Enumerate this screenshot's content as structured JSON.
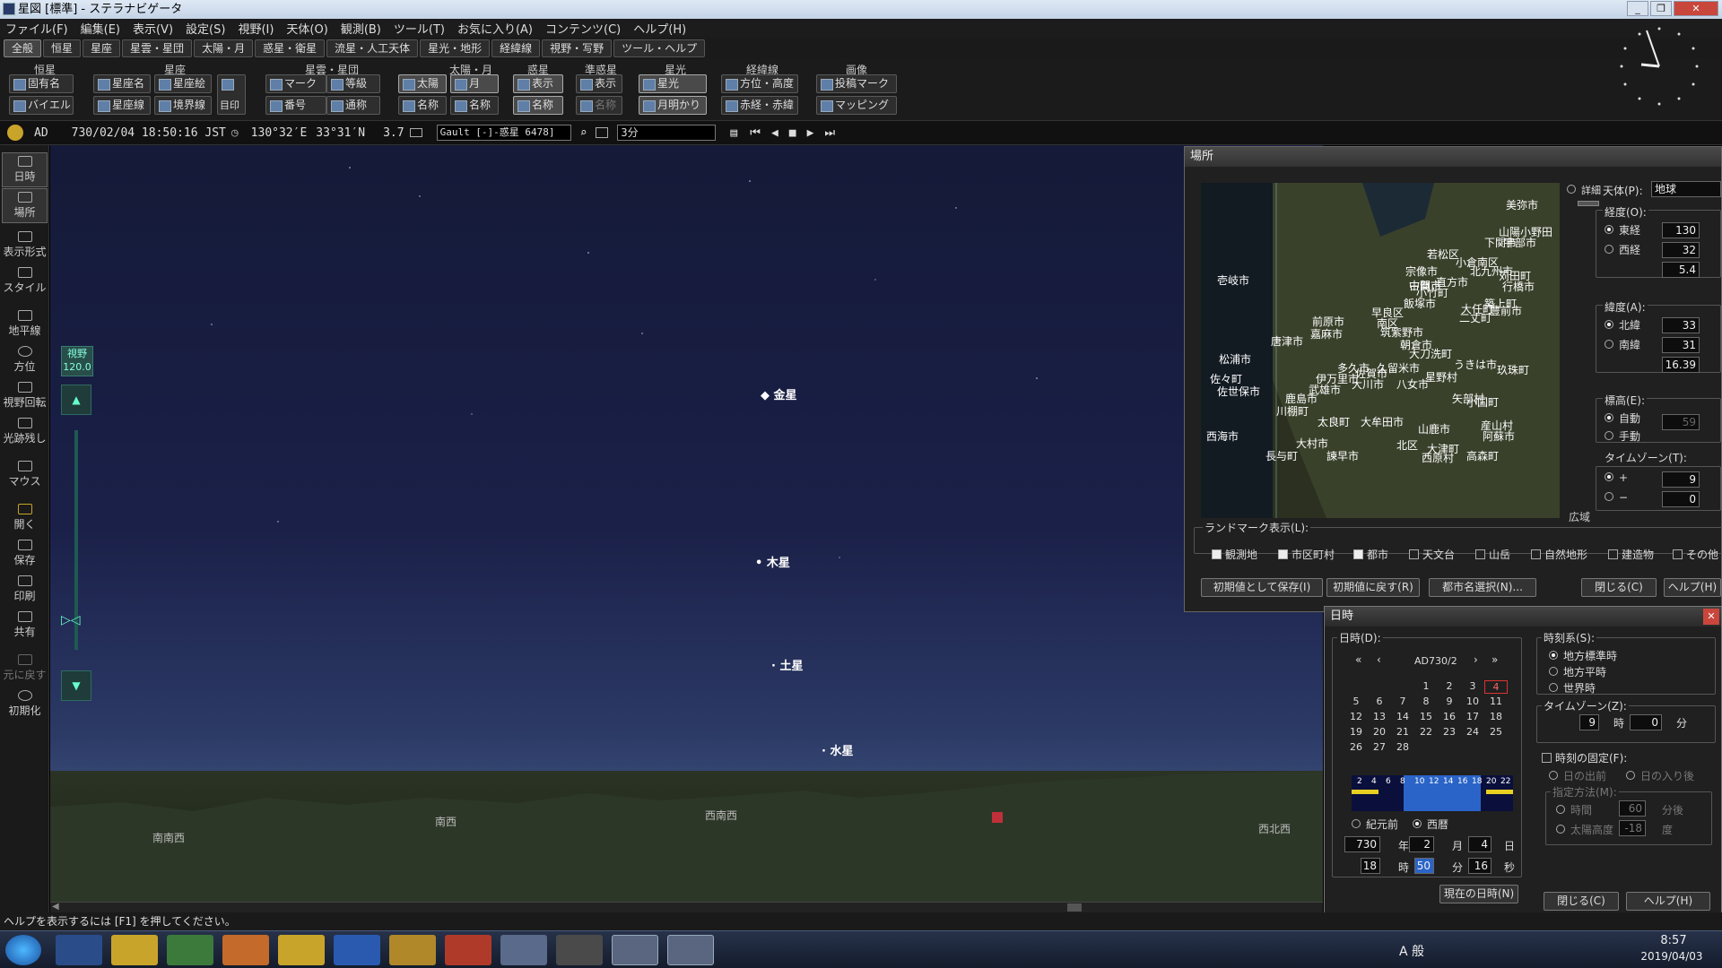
{
  "window": {
    "title": "星図 [標準] - ステラナビゲータ"
  },
  "menu": [
    "ファイル(F)",
    "編集(E)",
    "表示(V)",
    "設定(S)",
    "視野(I)",
    "天体(O)",
    "観測(B)",
    "ツール(T)",
    "お気に入り(A)",
    "コンテンツ(C)",
    "ヘルプ(H)"
  ],
  "tabs": [
    "全般",
    "恒星",
    "星座",
    "星雲・星団",
    "太陽・月",
    "惑星・衛星",
    "流星・人工天体",
    "星光・地形",
    "経緯線",
    "視野・写野",
    "ツール・ヘルプ"
  ],
  "ribbon": {
    "groups": [
      "恒星",
      "星座",
      "星雲・星団",
      "太陽・月",
      "惑星",
      "準惑星",
      "星光",
      "経緯線",
      "画像"
    ],
    "buttons": [
      "固有名",
      "バイエル",
      "星座名",
      "星座線",
      "星座絵",
      "境界線",
      "目印",
      "マーク",
      "番号",
      "等級",
      "通称",
      "太陽",
      "名称",
      "月",
      "名称",
      "表示",
      "名称",
      "表示",
      "名称",
      "星光",
      "月明かり",
      "方位・高度",
      "赤経・赤緯",
      "投稿マーク",
      "マッピング"
    ]
  },
  "status": {
    "era": "AD",
    "datetime": "730/02/04 18:50:16 JST",
    "longitude": "130°32′E",
    "latitude": "33°31′N",
    "magnitude": "3.7",
    "catalog": "Gault [-]-惑星 6478]",
    "step": "3分"
  },
  "leftbar": [
    "日時",
    "場所",
    "表示形式",
    "スタイル",
    "地平線",
    "方位",
    "視野回転",
    "光跡残し",
    "マウス",
    "開く",
    "保存",
    "印刷",
    "共有",
    "元に戻す",
    "初期化"
  ],
  "fov": {
    "label": "視野",
    "value": "120.0"
  },
  "sky": {
    "planets": [
      "金星",
      "木星",
      "土星",
      "水星"
    ],
    "directions": [
      "南南西",
      "南西",
      "西南西",
      "西北西"
    ]
  },
  "place_window": {
    "title": "場所",
    "detail": "詳細",
    "wide": "広域",
    "body_label": "天体(P):",
    "body_value": "地球",
    "lon_label": "経度(O):",
    "east": "東経",
    "west": "西経",
    "lon_deg": "130",
    "lon_min": "32",
    "lon_sec": "5.4",
    "lat_label": "緯度(A):",
    "north": "北緯",
    "south": "南緯",
    "lat_deg": "33",
    "lat_min": "31",
    "lat_sec": "16.39",
    "alt_label": "標高(E):",
    "auto": "自動",
    "manual": "手動",
    "alt_value": "59",
    "tz_label": "タイムゾーン(T):",
    "tz_plus": "+",
    "tz_minus": "−",
    "tz_h": "9",
    "tz_m": "0",
    "landmark_label": "ランドマーク表示(L):",
    "landmarks": [
      "観測地",
      "市区町村",
      "都市",
      "天文台",
      "山岳",
      "自然地形",
      "建造物",
      "その他"
    ],
    "buttons": [
      "初期値として保存(I)",
      "初期値に戻す(R)",
      "都市名選択(N)...",
      "閉じる(C)",
      "ヘルプ(H)"
    ],
    "map_labels": [
      "美弥市",
      "山陽小野田",
      "宇部市",
      "下関市",
      "若松区",
      "小倉南区",
      "北九州市",
      "宗像市",
      "中間市",
      "苅田町",
      "行橋市",
      "古賀市",
      "直方市",
      "小竹町",
      "築上町",
      "飯塚市",
      "大任町",
      "豊前市",
      "壱岐市",
      "前原市",
      "早良区",
      "南区",
      "二丈町",
      "嘉麻市",
      "筑紫野市",
      "唐津市",
      "朝倉市",
      "大刀洗町",
      "松浦市",
      "多久市",
      "久留米市",
      "うきは市",
      "伊万里市",
      "佐賀市",
      "玖珠町",
      "佐々町",
      "佐世保市",
      "武雄市",
      "大川市",
      "八女市",
      "星野村",
      "小国町",
      "鹿島市",
      "矢部村",
      "川棚町",
      "太良町",
      "大牟田市",
      "山鹿市",
      "産山村",
      "西海市",
      "大村市",
      "北区",
      "阿蘇市",
      "長与町",
      "諫早市",
      "大津町",
      "西原村",
      "高森町"
    ]
  },
  "date_window": {
    "title": "日時",
    "date_label": "日時(D):",
    "month_nav": "AD730/2",
    "days": [
      "1",
      "2",
      "3",
      "4",
      "5",
      "6",
      "7",
      "8",
      "9",
      "10",
      "11",
      "12",
      "13",
      "14",
      "15",
      "16",
      "17",
      "18",
      "19",
      "20",
      "21",
      "22",
      "23",
      "24",
      "25",
      "26",
      "27",
      "28"
    ],
    "bar_hours": [
      "2",
      "4",
      "6",
      "8",
      "10",
      "12",
      "14",
      "16",
      "18",
      "20",
      "22"
    ],
    "bc": "紀元前",
    "ad": "西暦",
    "year": "730",
    "month": "2",
    "day": "4",
    "hour": "18",
    "minute": "50",
    "second": "16",
    "u_year": "年",
    "u_month": "月",
    "u_day": "日",
    "u_hour": "時",
    "u_min": "分",
    "u_sec": "秒",
    "now_button": "現在の日時(N)",
    "tsys_label": "時刻系(S):",
    "tsys": [
      "地方標準時",
      "地方平時",
      "世界時"
    ],
    "tz_label": "タイムゾーン(Z):",
    "tz_h": "9",
    "tz_m": "0",
    "u_h": "時",
    "u_m": "分",
    "fix_label": "時刻の固定(F):",
    "sunrise": "日の出前",
    "sunset": "日の入り後",
    "spec_label": "指定方法(M):",
    "time": "時間",
    "sunalt": "太陽高度",
    "spec_time": "60",
    "spec_alt": "-18",
    "u_after": "分後",
    "u_deg": "度",
    "close": "閉じる(C)",
    "help": "ヘルプ(H)"
  },
  "bottom": {
    "help_text": "ヘルプを表示するには [F1] を押してください。"
  },
  "taskbar": {
    "ime": "A 般",
    "time": "8:57",
    "date": "2019/04/03"
  }
}
